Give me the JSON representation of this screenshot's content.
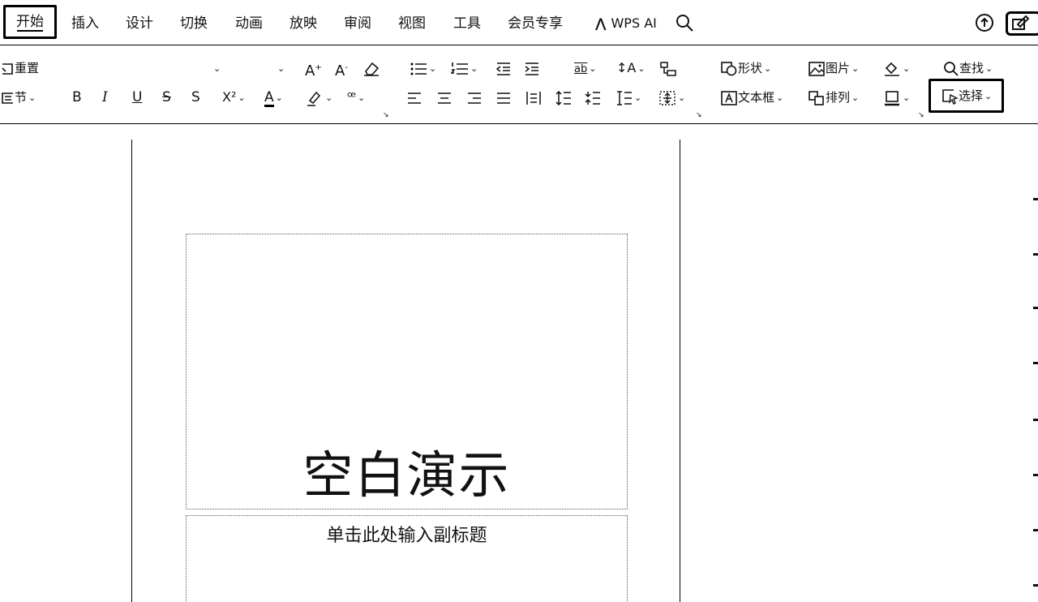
{
  "tabs": [
    "开始",
    "插入",
    "设计",
    "切换",
    "动画",
    "放映",
    "审阅",
    "视图",
    "工具",
    "会员专享"
  ],
  "ai_label": "WPS AI",
  "ribbon": {
    "reset": "重置",
    "section": "节",
    "shape": "形状",
    "picture": "图片",
    "find": "查找",
    "textbox": "文本框",
    "arrange": "排列",
    "select": "选择"
  },
  "format_icons": {
    "bold": "B",
    "italic": "I",
    "underline": "U",
    "strike": "S",
    "shadow": "S",
    "superscript": "X²",
    "font_color": "A"
  },
  "slide": {
    "title": "空白演示",
    "subtitle": "单击此处输入副标题"
  }
}
